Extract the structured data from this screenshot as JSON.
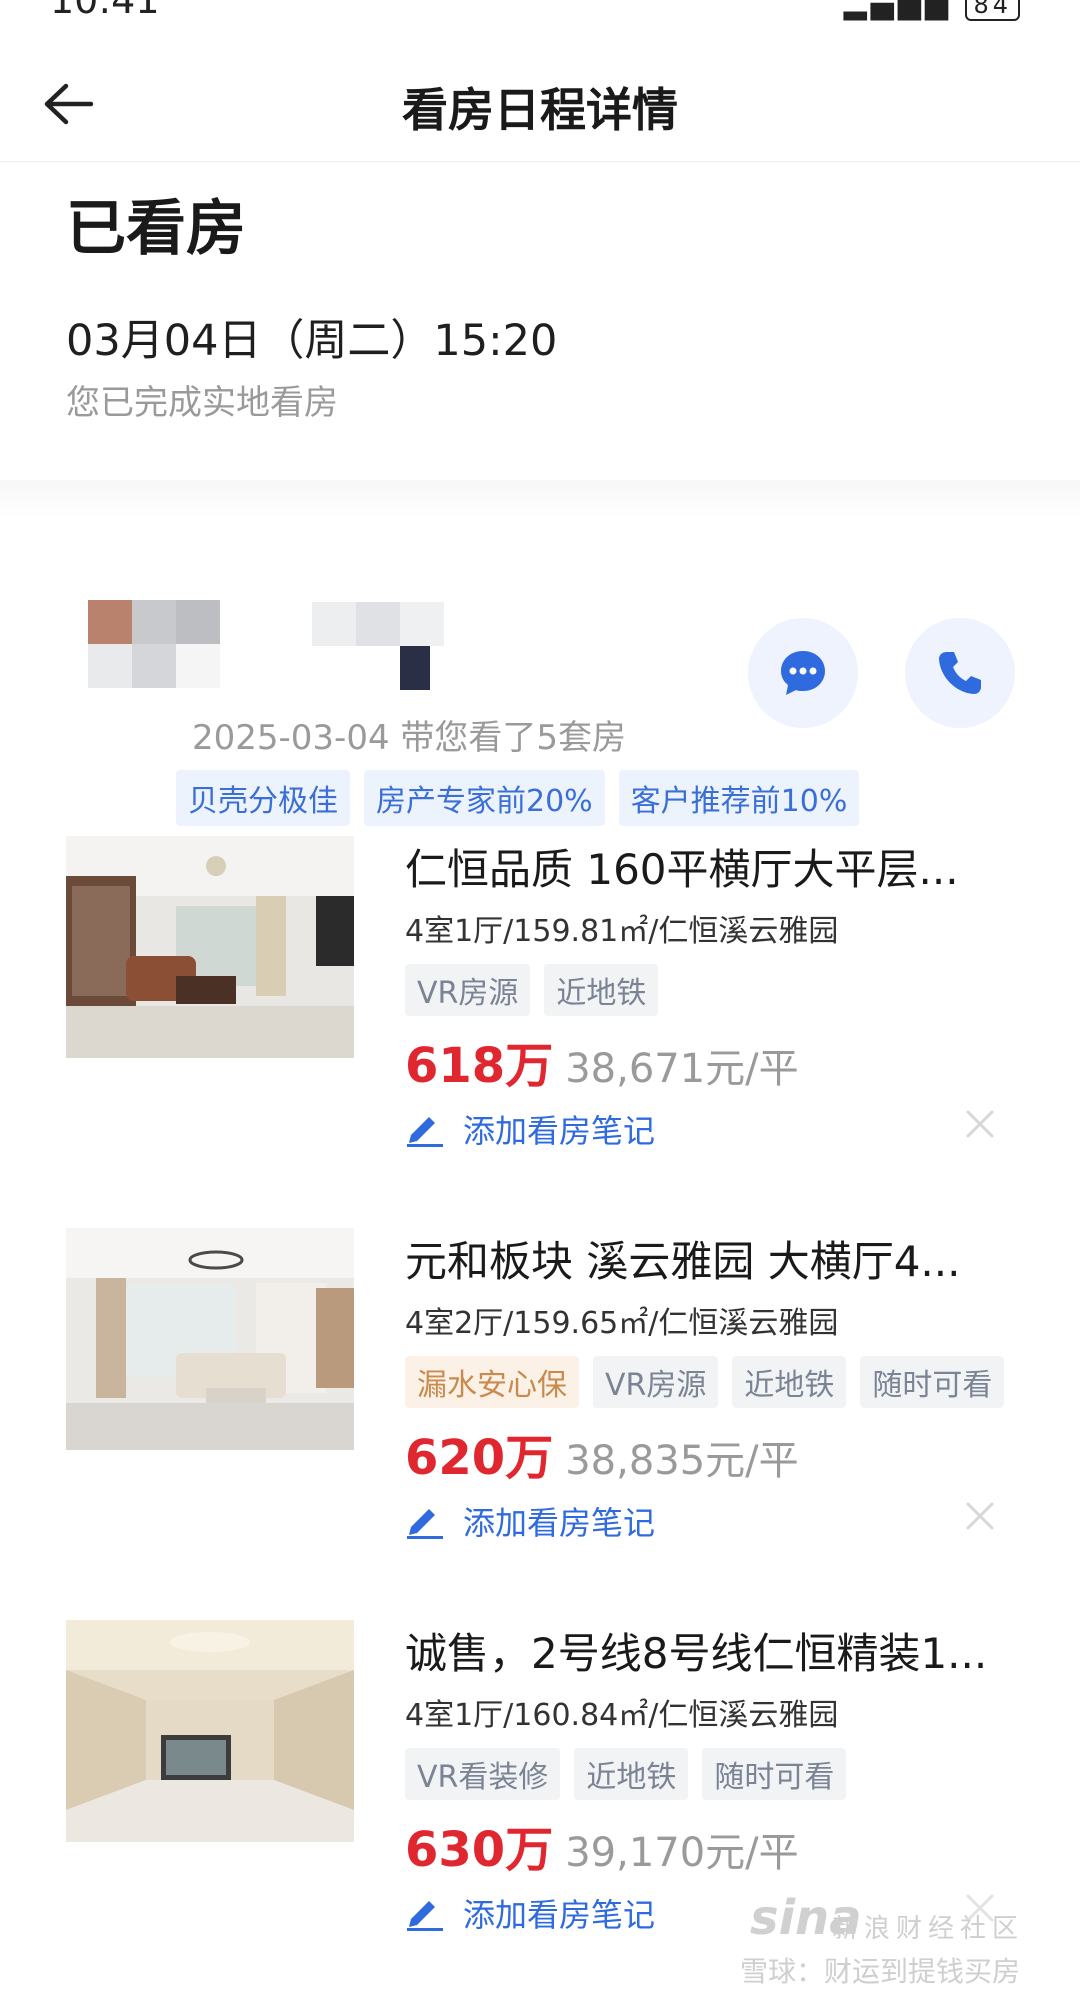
{
  "status_bar": {
    "time": "10:41",
    "battery": "84"
  },
  "header": {
    "title": "看房日程详情"
  },
  "visit": {
    "status_title": "已看房",
    "time": "03月04日（周二）15:20",
    "note": "您已完成实地看房"
  },
  "agent": {
    "summary": "2025-03-04 带您看了5套房",
    "tags": [
      "贝壳分极佳",
      "房产专家前20%",
      "客户推荐前10%"
    ]
  },
  "listings": [
    {
      "title": "仁恒品质 160平横厅大平层...",
      "spec": "4室1厅/159.81㎡/仁恒溪云雅园",
      "tags": [
        {
          "label": "VR房源",
          "style": "normal"
        },
        {
          "label": "近地铁",
          "style": "normal"
        }
      ],
      "total_price": "618万",
      "unit_price": "38,671元/平",
      "add_note": "添加看房笔记"
    },
    {
      "title": "元和板块 溪云雅园 大横厅4...",
      "spec": "4室2厅/159.65㎡/仁恒溪云雅园",
      "tags": [
        {
          "label": "漏水安心保",
          "style": "warm"
        },
        {
          "label": "VR房源",
          "style": "normal"
        },
        {
          "label": "近地铁",
          "style": "normal"
        },
        {
          "label": "随时可看",
          "style": "normal"
        }
      ],
      "total_price": "620万",
      "unit_price": "38,835元/平",
      "add_note": "添加看房笔记"
    },
    {
      "title": "诚售，2号线8号线仁恒精装1...",
      "spec": "4室1厅/160.84㎡/仁恒溪云雅园",
      "tags": [
        {
          "label": "VR看装修",
          "style": "normal"
        },
        {
          "label": "近地铁",
          "style": "normal"
        },
        {
          "label": "随时可看",
          "style": "normal"
        }
      ],
      "total_price": "630万",
      "unit_price": "39,170元/平",
      "add_note": "添加看房笔记"
    }
  ],
  "watermark": {
    "logo": "sina",
    "line1": "新浪财经社区",
    "line2": "雪球：财运到提钱买房"
  },
  "colors": {
    "accent": "#2f6bde",
    "price": "#e0272f",
    "tag_bg": "#edf3fd"
  }
}
